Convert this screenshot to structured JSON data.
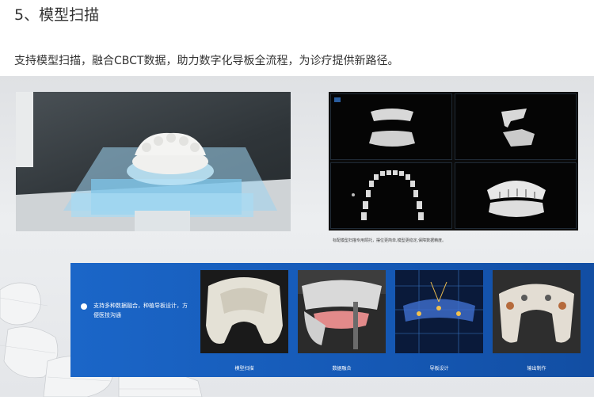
{
  "heading": "5、模型扫描",
  "description": "支持模型扫描，融合CBCT数据，助力数字化导板全流程，为诊疗提供新路径。",
  "ct_caption": "标配模型扫描专用颌托，摆位更简单,模型更稳定,保障数据精度。",
  "feature_text": "支持多种数据融合，种植导板设计，方便医技沟通",
  "steps": [
    {
      "label": "模型扫描",
      "icon": "jaw-scan-image"
    },
    {
      "label": "数据融合",
      "icon": "data-fusion-image"
    },
    {
      "label": "导板设计",
      "icon": "guide-design-image"
    },
    {
      "label": "输出制作",
      "icon": "printed-guide-image"
    }
  ],
  "colors": {
    "band": "#1558b4",
    "text": "#333333",
    "banner_bg": "#e4e6e9"
  }
}
